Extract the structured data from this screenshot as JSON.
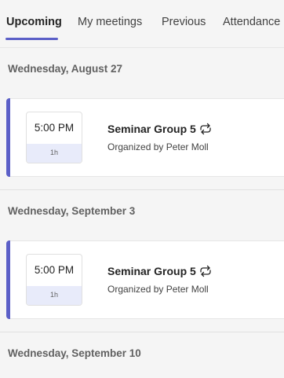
{
  "tabs": [
    {
      "label": "Upcoming",
      "active": true
    },
    {
      "label": "My meetings",
      "active": false
    },
    {
      "label": "Previous",
      "active": false
    },
    {
      "label": "Attendance",
      "active": false
    }
  ],
  "colors": {
    "accent": "#5b5fc7",
    "duration_band": "#e8ebfa",
    "background": "#f5f5f5"
  },
  "groups": [
    {
      "date": "Wednesday, August 27",
      "meeting": {
        "time": "5:00 PM",
        "duration": "1h",
        "title": "Seminar Group 5",
        "recurring_icon": "recurring-icon",
        "organizer": "Organized by Peter Moll"
      }
    },
    {
      "date": "Wednesday, September 3",
      "meeting": {
        "time": "5:00 PM",
        "duration": "1h",
        "title": "Seminar Group 5",
        "recurring_icon": "recurring-icon",
        "organizer": "Organized by Peter Moll"
      }
    },
    {
      "date": "Wednesday, September 10"
    }
  ]
}
